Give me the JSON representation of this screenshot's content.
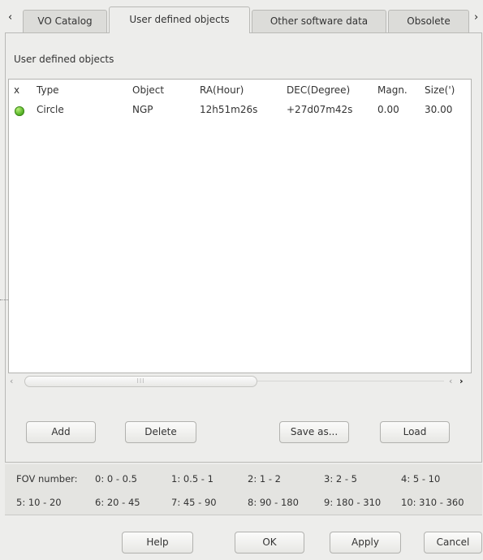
{
  "tabs": {
    "items": [
      "VO Catalog",
      "User defined objects",
      "Other software data",
      "Obsolete"
    ],
    "active": "User defined objects"
  },
  "section": {
    "title": "User defined objects"
  },
  "table": {
    "columns": [
      "x",
      "Type",
      "Object",
      "RA(Hour)",
      "DEC(Degree)",
      "Magn.",
      "Size(')"
    ],
    "rows": [
      {
        "type": "Circle",
        "object": "NGP",
        "ra": "12h51m26s",
        "dec": "+27d07m42s",
        "magn": "0.00",
        "size": "30.00",
        "status_color": "#5cb82b"
      }
    ]
  },
  "buttons": {
    "add": "Add",
    "delete": "Delete",
    "save_as": "Save as...",
    "load": "Load"
  },
  "fov": {
    "label": "FOV number:",
    "items": [
      "0: 0 - 0.5",
      "1: 0.5 - 1",
      "2: 1 - 2",
      "3: 2 - 5",
      "4: 5 - 10",
      "5: 10 - 20",
      "6: 20 - 45",
      "7: 45 - 90",
      "8: 90 - 180",
      "9: 180 - 310",
      "10: 310 - 360"
    ]
  },
  "dialog": {
    "help": "Help",
    "ok": "OK",
    "apply": "Apply",
    "cancel": "Cancel"
  },
  "scrollbar": {
    "grip": "III",
    "left_arrow": "‹",
    "prev_arrow": "‹",
    "next_arrow": "›"
  },
  "tab_arrows": {
    "left": "‹",
    "right": "›"
  }
}
